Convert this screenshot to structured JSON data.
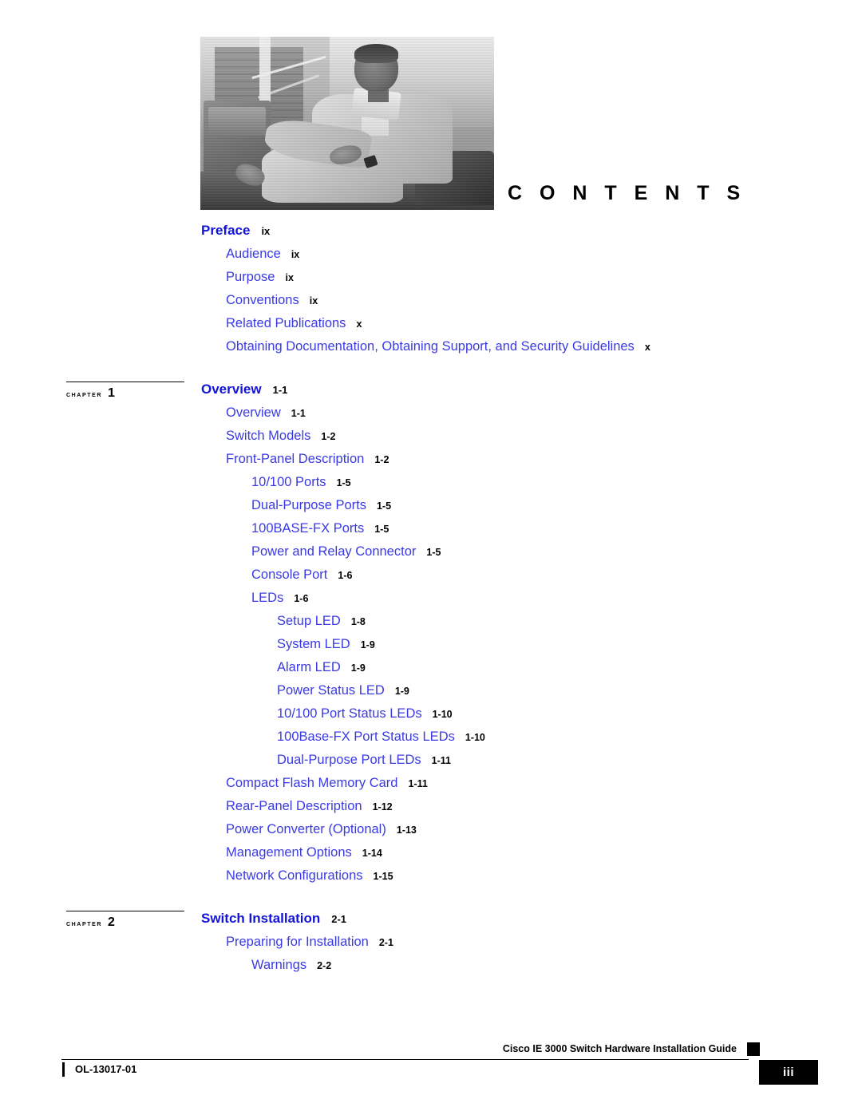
{
  "document": {
    "heading": "C O N T E N T S",
    "hero_image_alt": "man-seated-photo"
  },
  "toc": {
    "preface": {
      "label": "Preface",
      "page": "ix",
      "entries": [
        {
          "label": "Audience",
          "page": "ix",
          "level": 2
        },
        {
          "label": "Purpose",
          "page": "ix",
          "level": 2
        },
        {
          "label": "Conventions",
          "page": "ix",
          "level": 2
        },
        {
          "label": "Related Publications",
          "page": "x",
          "level": 2
        },
        {
          "label": "Obtaining Documentation, Obtaining Support, and Security Guidelines",
          "page": "x",
          "level": 2
        }
      ]
    },
    "chapters": [
      {
        "chapter_word": "CHAPTER",
        "chapter_number": "1",
        "label": "Overview",
        "page": "1-1",
        "entries": [
          {
            "label": "Overview",
            "page": "1-1",
            "level": 2
          },
          {
            "label": "Switch Models",
            "page": "1-2",
            "level": 2
          },
          {
            "label": "Front-Panel Description",
            "page": "1-2",
            "level": 2
          },
          {
            "label": "10/100 Ports",
            "page": "1-5",
            "level": 3
          },
          {
            "label": "Dual-Purpose Ports",
            "page": "1-5",
            "level": 3
          },
          {
            "label": "100BASE-FX Ports",
            "page": "1-5",
            "level": 3
          },
          {
            "label": "Power and Relay Connector",
            "page": "1-5",
            "level": 3
          },
          {
            "label": "Console Port",
            "page": "1-6",
            "level": 3
          },
          {
            "label": "LEDs",
            "page": "1-6",
            "level": 3
          },
          {
            "label": "Setup LED",
            "page": "1-8",
            "level": 4
          },
          {
            "label": "System LED",
            "page": "1-9",
            "level": 4
          },
          {
            "label": "Alarm LED",
            "page": "1-9",
            "level": 4
          },
          {
            "label": "Power Status LED",
            "page": "1-9",
            "level": 4
          },
          {
            "label": "10/100 Port Status LEDs",
            "page": "1-10",
            "level": 4
          },
          {
            "label": "100Base-FX Port Status LEDs",
            "page": "1-10",
            "level": 4
          },
          {
            "label": "Dual-Purpose Port LEDs",
            "page": "1-11",
            "level": 4
          },
          {
            "label": "Compact Flash Memory Card",
            "page": "1-11",
            "level": 2
          },
          {
            "label": "Rear-Panel Description",
            "page": "1-12",
            "level": 2
          },
          {
            "label": "Power Converter (Optional)",
            "page": "1-13",
            "level": 2
          },
          {
            "label": "Management Options",
            "page": "1-14",
            "level": 2
          },
          {
            "label": "Network Configurations",
            "page": "1-15",
            "level": 2
          }
        ]
      },
      {
        "chapter_word": "CHAPTER",
        "chapter_number": "2",
        "label": "Switch Installation",
        "page": "2-1",
        "entries": [
          {
            "label": "Preparing for Installation",
            "page": "2-1",
            "level": 2
          },
          {
            "label": "Warnings",
            "page": "2-2",
            "level": 3
          }
        ]
      }
    ]
  },
  "footer": {
    "guide_title": "Cisco IE 3000 Switch Hardware Installation Guide",
    "doc_id": "OL-13017-01",
    "page_number": "iii"
  },
  "colors": {
    "heading_blue": "#1414D8",
    "entry_blue": "#3A3AE4",
    "page_black": "#000000",
    "footer_box": "#000000"
  }
}
